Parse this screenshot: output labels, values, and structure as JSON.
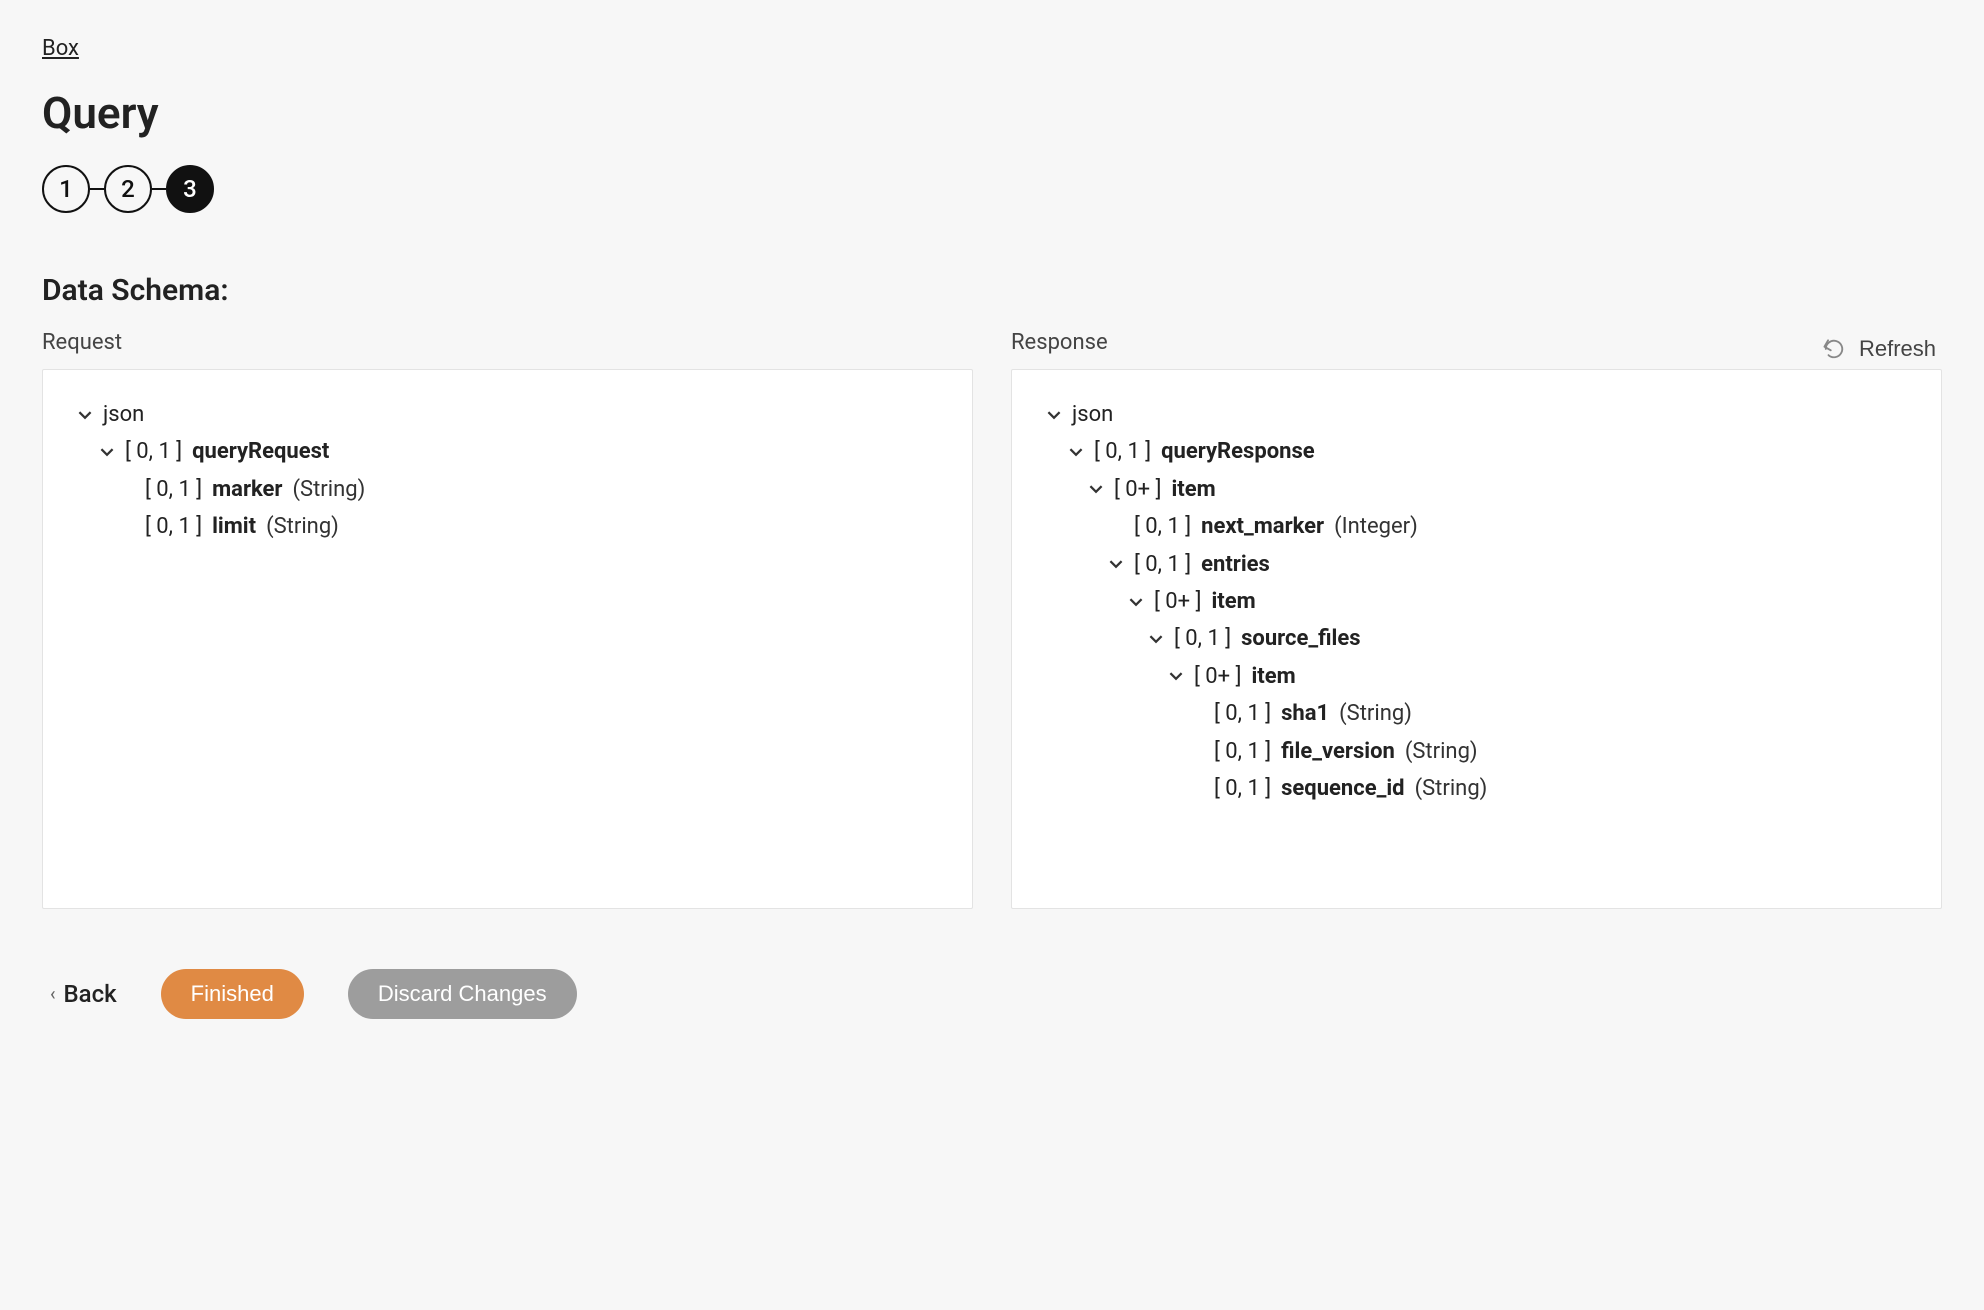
{
  "breadcrumb": "Box",
  "page_title": "Query",
  "stepper": {
    "steps": [
      "1",
      "2",
      "3"
    ],
    "active_index": 2
  },
  "section_title": "Data Schema:",
  "refresh_label": "Refresh",
  "panels": {
    "request_label": "Request",
    "response_label": "Response"
  },
  "request_tree": {
    "root": "json",
    "node1": {
      "card": "[ 0, 1 ]",
      "name": "queryRequest"
    },
    "leaf_marker": {
      "card": "[ 0, 1 ]",
      "name": "marker",
      "type": "(String)"
    },
    "leaf_limit": {
      "card": "[ 0, 1 ]",
      "name": "limit",
      "type": "(String)"
    }
  },
  "response_tree": {
    "root": "json",
    "node1": {
      "card": "[ 0, 1 ]",
      "name": "queryResponse"
    },
    "node2": {
      "card": "[ 0+ ]",
      "name": "item"
    },
    "leaf_next_marker": {
      "card": "[ 0, 1 ]",
      "name": "next_marker",
      "type": "(Integer)"
    },
    "node_entries": {
      "card": "[ 0, 1 ]",
      "name": "entries"
    },
    "node_entries_item": {
      "card": "[ 0+ ]",
      "name": "item"
    },
    "node_source_files": {
      "card": "[ 0, 1 ]",
      "name": "source_files"
    },
    "node_source_item": {
      "card": "[ 0+ ]",
      "name": "item"
    },
    "leaf_sha1": {
      "card": "[ 0, 1 ]",
      "name": "sha1",
      "type": "(String)"
    },
    "leaf_file_version": {
      "card": "[ 0, 1 ]",
      "name": "file_version",
      "type": "(String)"
    },
    "leaf_sequence_id": {
      "card": "[ 0, 1 ]",
      "name": "sequence_id",
      "type": "(String)"
    }
  },
  "footer": {
    "back": "Back",
    "finished": "Finished",
    "discard": "Discard Changes"
  }
}
